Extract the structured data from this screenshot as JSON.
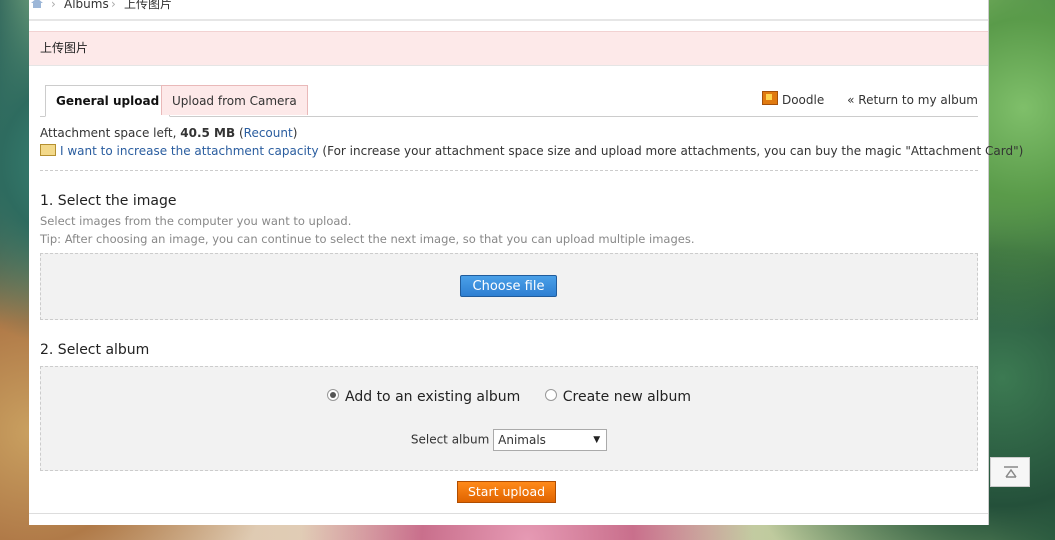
{
  "breadcrumb": {
    "level1": "Albums",
    "level2": "上传图片"
  },
  "title": "上传图片",
  "tabs": [
    {
      "label": "General upload",
      "active": true
    },
    {
      "label": "Upload from Camera",
      "active": false
    }
  ],
  "top_links": {
    "doodle": "Doodle",
    "return": "« Return to my album"
  },
  "attachment": {
    "prefix": "Attachment space left,",
    "amount": "40.5 MB",
    "recount": "Recount",
    "increase_link": "I want to increase the attachment capacity",
    "increase_note": "(For increase your attachment space size and upload more attachments, you can buy the magic \"Attachment Card\")"
  },
  "step1": {
    "heading": "1. Select the image",
    "hint1": "Select images from the computer you want to upload.",
    "hint2": "Tip: After choosing an image, you can continue to select the next image, so that you can upload multiple images.",
    "choose_label": "Choose file"
  },
  "step2": {
    "heading": "2. Select album",
    "option_existing": "Add to an existing album",
    "option_new": "Create new album",
    "selected_option": "existing",
    "select_label": "Select album",
    "select_value": "Animals"
  },
  "start_label": "Start upload",
  "colors": {
    "start_button": "#f07a10",
    "choose_button": "#3a8ede",
    "title_bg": "#fde9e9"
  }
}
